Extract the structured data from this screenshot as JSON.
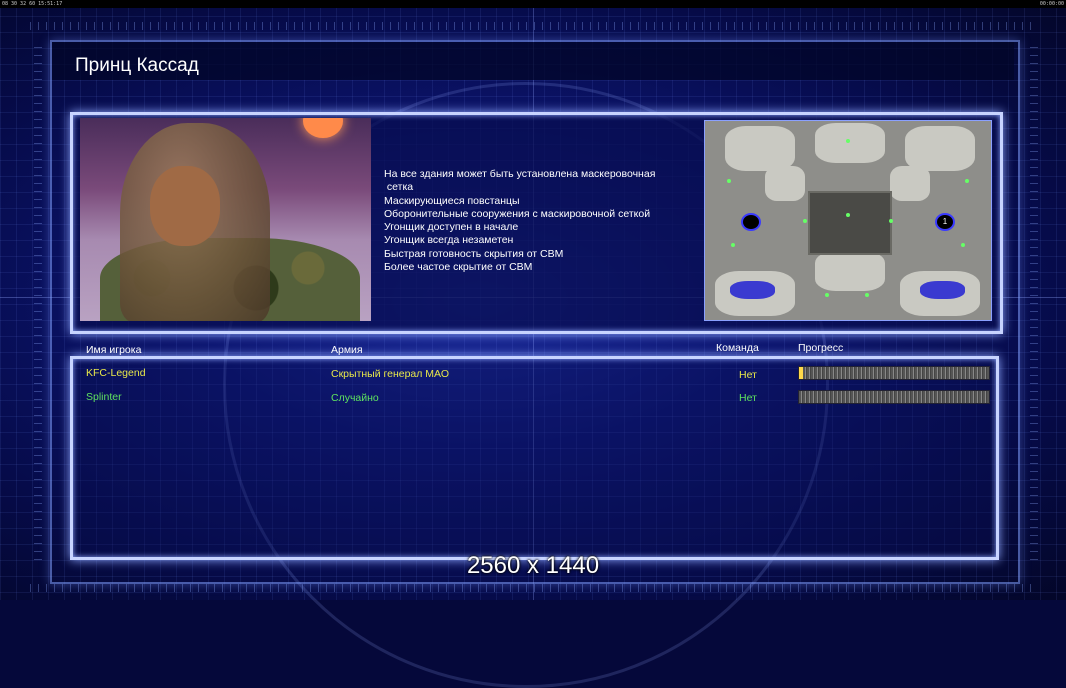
{
  "statusbar": {
    "left": "08 30 32 60 15:51:17",
    "right": "00:00:00"
  },
  "title": "Принц Кассад",
  "description_lines": [
    "На все здания может быть установлена маскеровочная",
    " сетка",
    "Маскирующиеся повстанцы",
    "Оборонительные сооружения с маскировочной сеткой",
    "Угонщик доступен в начале",
    "Угонщик всегда незаметен",
    "Быстрая готовность скрытия от СВМ",
    "Более частое скрытие от СВМ"
  ],
  "minimap": {
    "start_markers": [
      "",
      "1"
    ]
  },
  "table": {
    "headers": {
      "player": "Имя игрока",
      "army": "Армия",
      "team": "Команда",
      "progress": "Прогресс"
    },
    "rows": [
      {
        "player": "KFC-Legend",
        "army": "Скрытный генерал МАО",
        "team": "Нет",
        "progress": 0.02,
        "color": "#e8e84a"
      },
      {
        "player": "Splinter",
        "army": "Случайно",
        "team": "Нет",
        "progress": 0.0,
        "color": "#5fe35f"
      }
    ]
  },
  "resolution_label": "2560 x 1440"
}
